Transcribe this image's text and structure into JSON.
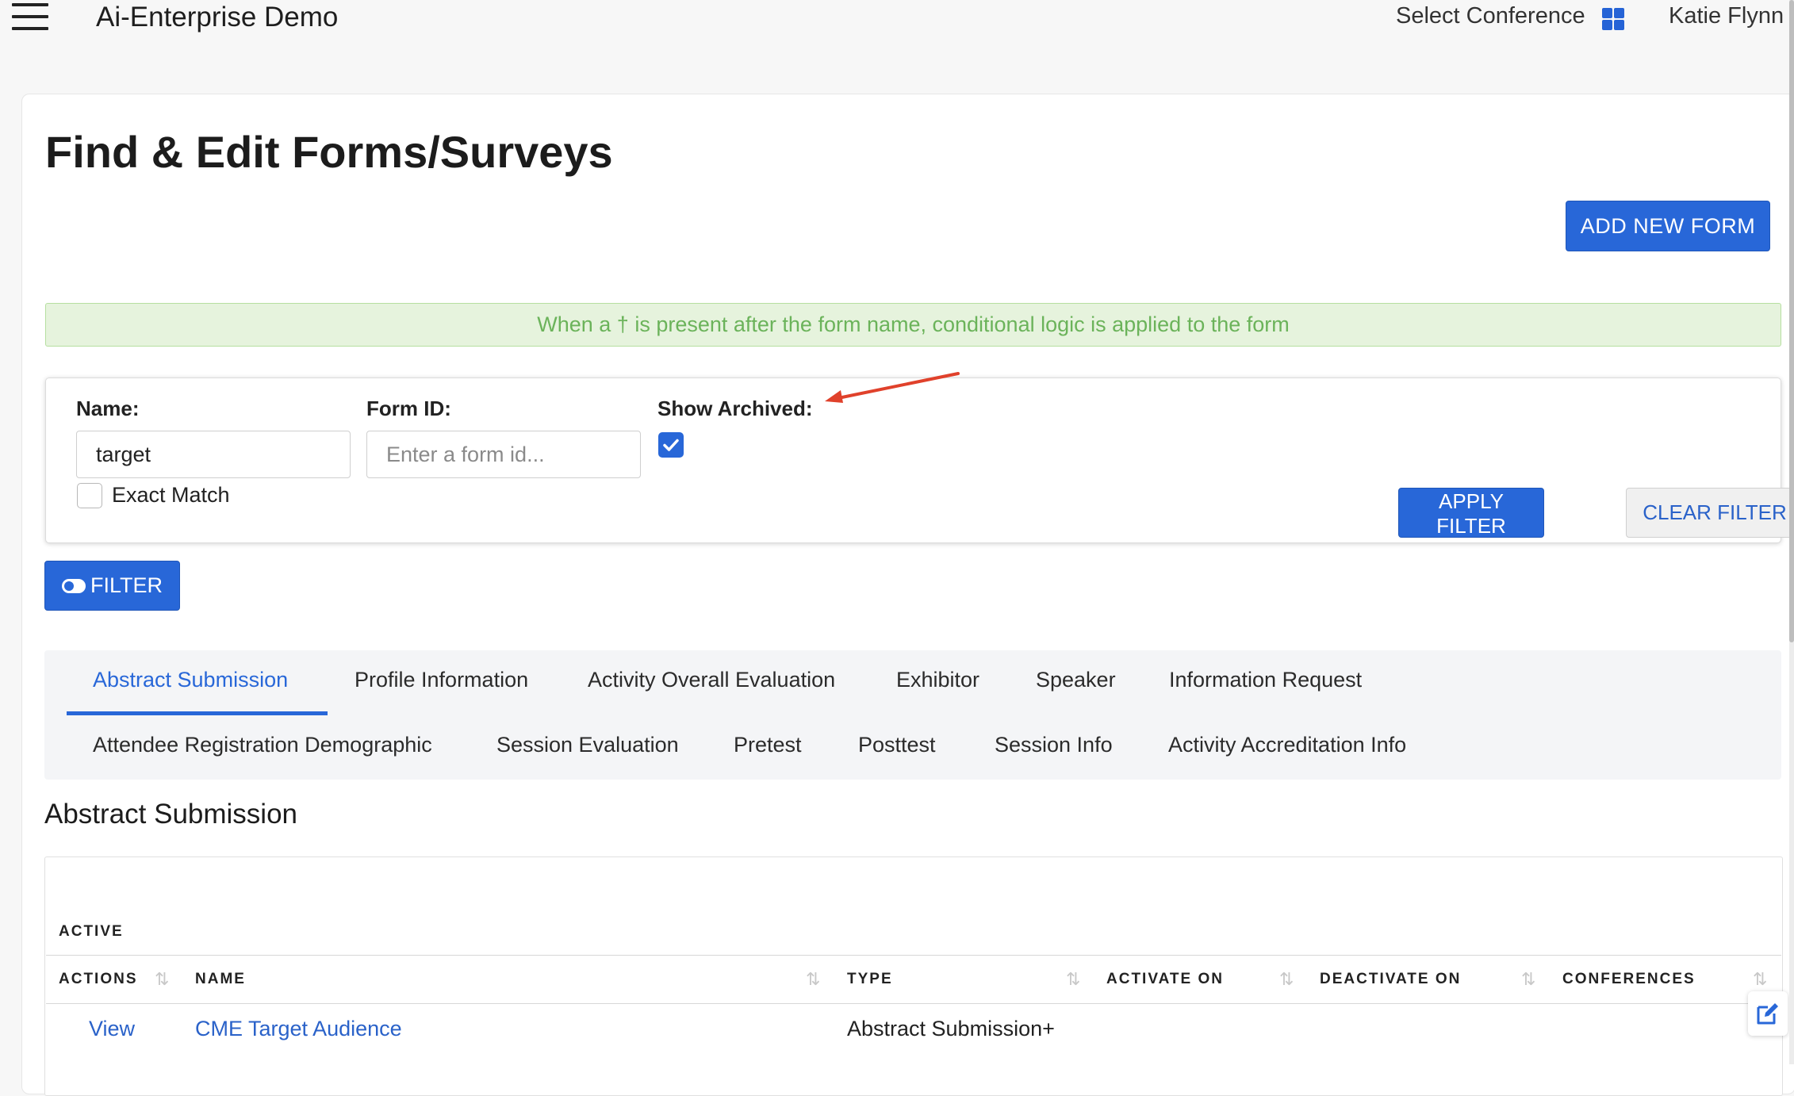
{
  "header": {
    "app_title": "Ai-Enterprise Demo",
    "select_conference": "Select Conference",
    "user_name": "Katie Flynn"
  },
  "page": {
    "title": "Find & Edit Forms/Surveys",
    "add_button": "ADD NEW FORM",
    "alert": "When a † is present after the form name, conditional logic is applied to the form"
  },
  "filter": {
    "name_label": "Name:",
    "name_value": "target",
    "exact_match_label": "Exact Match",
    "exact_match_checked": false,
    "form_id_label": "Form ID:",
    "form_id_placeholder": "Enter a form id...",
    "show_archived_label": "Show Archived:",
    "show_archived_checked": true,
    "apply_button": "APPLY FILTER",
    "clear_button": "CLEAR FILTER",
    "toggle_button": "FILTER"
  },
  "tabs": [
    {
      "label": "Abstract Submission",
      "active": true
    },
    {
      "label": "Profile Information"
    },
    {
      "label": "Activity Overall Evaluation"
    },
    {
      "label": "Exhibitor"
    },
    {
      "label": "Speaker"
    },
    {
      "label": "Information Request"
    },
    {
      "label": "Attendee Registration Demographic"
    },
    {
      "label": "Session Evaluation"
    },
    {
      "label": "Pretest"
    },
    {
      "label": "Posttest"
    },
    {
      "label": "Session Info"
    },
    {
      "label": "Activity Accreditation Info"
    }
  ],
  "section": {
    "title": "Abstract Submission",
    "group_label": "ACTIVE",
    "columns": [
      "ACTIONS",
      "NAME",
      "TYPE",
      "ACTIVATE ON",
      "DEACTIVATE ON",
      "CONFERENCES"
    ],
    "rows": [
      {
        "action": "View",
        "name": "CME Target Audience",
        "type": "Abstract Submission+",
        "activate_on": "",
        "deactivate_on": "",
        "conferences": ""
      }
    ]
  },
  "colors": {
    "primary": "#2867d8",
    "link": "#2a62c9",
    "alert_bg": "#e6f3dd",
    "alert_text": "#6bb35a",
    "annotation_arrow": "#e0412b"
  },
  "icons": {
    "menu": "hamburger-icon",
    "conference": "grid-icon",
    "filter_toggle": "toggle-icon",
    "sort": "sort-icon",
    "edit": "edit-icon",
    "check": "check-icon"
  }
}
